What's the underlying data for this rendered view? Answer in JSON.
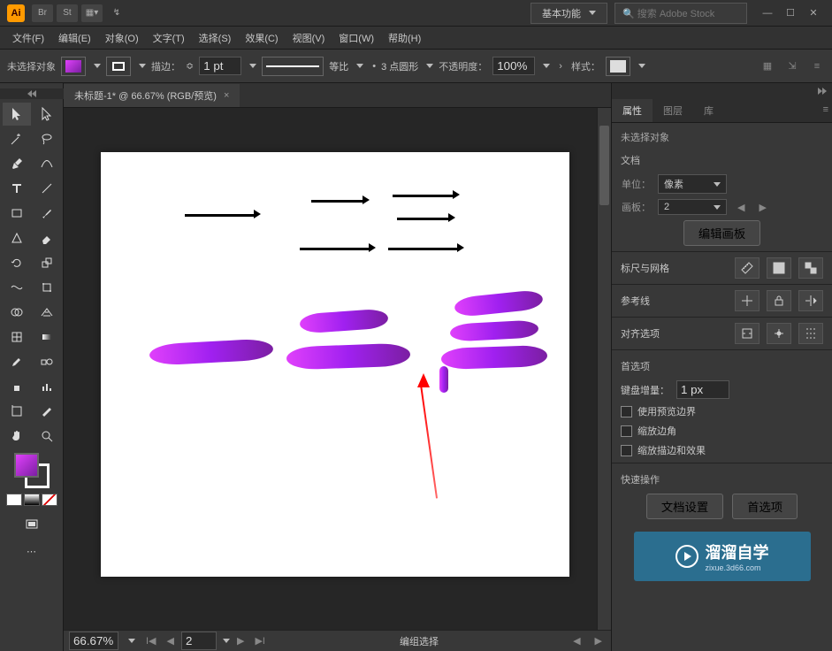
{
  "titlebar": {
    "logo": "Ai",
    "bridge": "Br",
    "stock": "St",
    "workspace": "基本功能",
    "search_placeholder": "搜索 Adobe Stock",
    "search_icon": "🔍"
  },
  "menubar": {
    "file": "文件(F)",
    "edit": "编辑(E)",
    "object": "对象(O)",
    "type": "文字(T)",
    "select": "选择(S)",
    "effect": "效果(C)",
    "view": "视图(V)",
    "window": "窗口(W)",
    "help": "帮助(H)"
  },
  "options": {
    "no_selection": "未选择对象",
    "stroke_label": "描边：",
    "stroke_value": "1 pt",
    "uniform_label": "等比",
    "profile_label": "3 点圆形",
    "opacity_label": "不透明度：",
    "opacity_value": "100%",
    "style_label": "样式："
  },
  "doc": {
    "tab_title": "未标题-1* @ 66.67% (RGB/预览)"
  },
  "status": {
    "zoom": "66.67%",
    "artboard": "2",
    "tool": "编组选择"
  },
  "panels": {
    "tabs": {
      "properties": "属性",
      "layers": "图层",
      "libraries": "库"
    },
    "no_selection": "未选择对象",
    "document": "文档",
    "unit_label": "单位：",
    "unit_value": "像素",
    "artboard_label": "画板：",
    "artboard_value": "2",
    "edit_artboards": "编辑画板",
    "rulers_grids": "标尺与网格",
    "guides": "参考线",
    "align": "对齐选项",
    "preferences": "首选项",
    "kbd_increment_label": "键盘增量：",
    "kbd_increment_value": "1 px",
    "use_preview_bounds": "使用预览边界",
    "scale_corners": "缩放边角",
    "scale_strokes": "缩放描边和效果",
    "quick_actions": "快速操作",
    "doc_setup": "文档设置",
    "prefs_btn": "首选项"
  },
  "watermark": {
    "brand": "溜溜自学",
    "url": "zixue.3d66.com"
  }
}
